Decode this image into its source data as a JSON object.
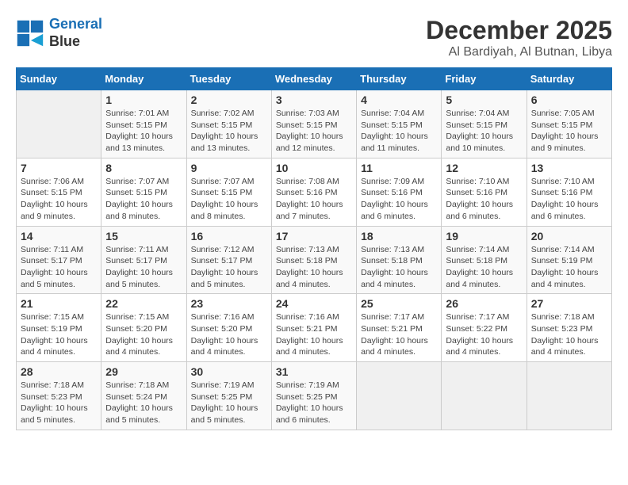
{
  "header": {
    "logo_line1": "General",
    "logo_line2": "Blue",
    "month": "December 2025",
    "location": "Al Bardiyah, Al Butnan, Libya"
  },
  "days_of_week": [
    "Sunday",
    "Monday",
    "Tuesday",
    "Wednesday",
    "Thursday",
    "Friday",
    "Saturday"
  ],
  "weeks": [
    [
      {
        "day": "",
        "info": ""
      },
      {
        "day": "1",
        "info": "Sunrise: 7:01 AM\nSunset: 5:15 PM\nDaylight: 10 hours\nand 13 minutes."
      },
      {
        "day": "2",
        "info": "Sunrise: 7:02 AM\nSunset: 5:15 PM\nDaylight: 10 hours\nand 13 minutes."
      },
      {
        "day": "3",
        "info": "Sunrise: 7:03 AM\nSunset: 5:15 PM\nDaylight: 10 hours\nand 12 minutes."
      },
      {
        "day": "4",
        "info": "Sunrise: 7:04 AM\nSunset: 5:15 PM\nDaylight: 10 hours\nand 11 minutes."
      },
      {
        "day": "5",
        "info": "Sunrise: 7:04 AM\nSunset: 5:15 PM\nDaylight: 10 hours\nand 10 minutes."
      },
      {
        "day": "6",
        "info": "Sunrise: 7:05 AM\nSunset: 5:15 PM\nDaylight: 10 hours\nand 9 minutes."
      }
    ],
    [
      {
        "day": "7",
        "info": "Sunrise: 7:06 AM\nSunset: 5:15 PM\nDaylight: 10 hours\nand 9 minutes."
      },
      {
        "day": "8",
        "info": "Sunrise: 7:07 AM\nSunset: 5:15 PM\nDaylight: 10 hours\nand 8 minutes."
      },
      {
        "day": "9",
        "info": "Sunrise: 7:07 AM\nSunset: 5:15 PM\nDaylight: 10 hours\nand 8 minutes."
      },
      {
        "day": "10",
        "info": "Sunrise: 7:08 AM\nSunset: 5:16 PM\nDaylight: 10 hours\nand 7 minutes."
      },
      {
        "day": "11",
        "info": "Sunrise: 7:09 AM\nSunset: 5:16 PM\nDaylight: 10 hours\nand 6 minutes."
      },
      {
        "day": "12",
        "info": "Sunrise: 7:10 AM\nSunset: 5:16 PM\nDaylight: 10 hours\nand 6 minutes."
      },
      {
        "day": "13",
        "info": "Sunrise: 7:10 AM\nSunset: 5:16 PM\nDaylight: 10 hours\nand 6 minutes."
      }
    ],
    [
      {
        "day": "14",
        "info": "Sunrise: 7:11 AM\nSunset: 5:17 PM\nDaylight: 10 hours\nand 5 minutes."
      },
      {
        "day": "15",
        "info": "Sunrise: 7:11 AM\nSunset: 5:17 PM\nDaylight: 10 hours\nand 5 minutes."
      },
      {
        "day": "16",
        "info": "Sunrise: 7:12 AM\nSunset: 5:17 PM\nDaylight: 10 hours\nand 5 minutes."
      },
      {
        "day": "17",
        "info": "Sunrise: 7:13 AM\nSunset: 5:18 PM\nDaylight: 10 hours\nand 4 minutes."
      },
      {
        "day": "18",
        "info": "Sunrise: 7:13 AM\nSunset: 5:18 PM\nDaylight: 10 hours\nand 4 minutes."
      },
      {
        "day": "19",
        "info": "Sunrise: 7:14 AM\nSunset: 5:18 PM\nDaylight: 10 hours\nand 4 minutes."
      },
      {
        "day": "20",
        "info": "Sunrise: 7:14 AM\nSunset: 5:19 PM\nDaylight: 10 hours\nand 4 minutes."
      }
    ],
    [
      {
        "day": "21",
        "info": "Sunrise: 7:15 AM\nSunset: 5:19 PM\nDaylight: 10 hours\nand 4 minutes."
      },
      {
        "day": "22",
        "info": "Sunrise: 7:15 AM\nSunset: 5:20 PM\nDaylight: 10 hours\nand 4 minutes."
      },
      {
        "day": "23",
        "info": "Sunrise: 7:16 AM\nSunset: 5:20 PM\nDaylight: 10 hours\nand 4 minutes."
      },
      {
        "day": "24",
        "info": "Sunrise: 7:16 AM\nSunset: 5:21 PM\nDaylight: 10 hours\nand 4 minutes."
      },
      {
        "day": "25",
        "info": "Sunrise: 7:17 AM\nSunset: 5:21 PM\nDaylight: 10 hours\nand 4 minutes."
      },
      {
        "day": "26",
        "info": "Sunrise: 7:17 AM\nSunset: 5:22 PM\nDaylight: 10 hours\nand 4 minutes."
      },
      {
        "day": "27",
        "info": "Sunrise: 7:18 AM\nSunset: 5:23 PM\nDaylight: 10 hours\nand 4 minutes."
      }
    ],
    [
      {
        "day": "28",
        "info": "Sunrise: 7:18 AM\nSunset: 5:23 PM\nDaylight: 10 hours\nand 5 minutes."
      },
      {
        "day": "29",
        "info": "Sunrise: 7:18 AM\nSunset: 5:24 PM\nDaylight: 10 hours\nand 5 minutes."
      },
      {
        "day": "30",
        "info": "Sunrise: 7:19 AM\nSunset: 5:25 PM\nDaylight: 10 hours\nand 5 minutes."
      },
      {
        "day": "31",
        "info": "Sunrise: 7:19 AM\nSunset: 5:25 PM\nDaylight: 10 hours\nand 6 minutes."
      },
      {
        "day": "",
        "info": ""
      },
      {
        "day": "",
        "info": ""
      },
      {
        "day": "",
        "info": ""
      }
    ]
  ]
}
